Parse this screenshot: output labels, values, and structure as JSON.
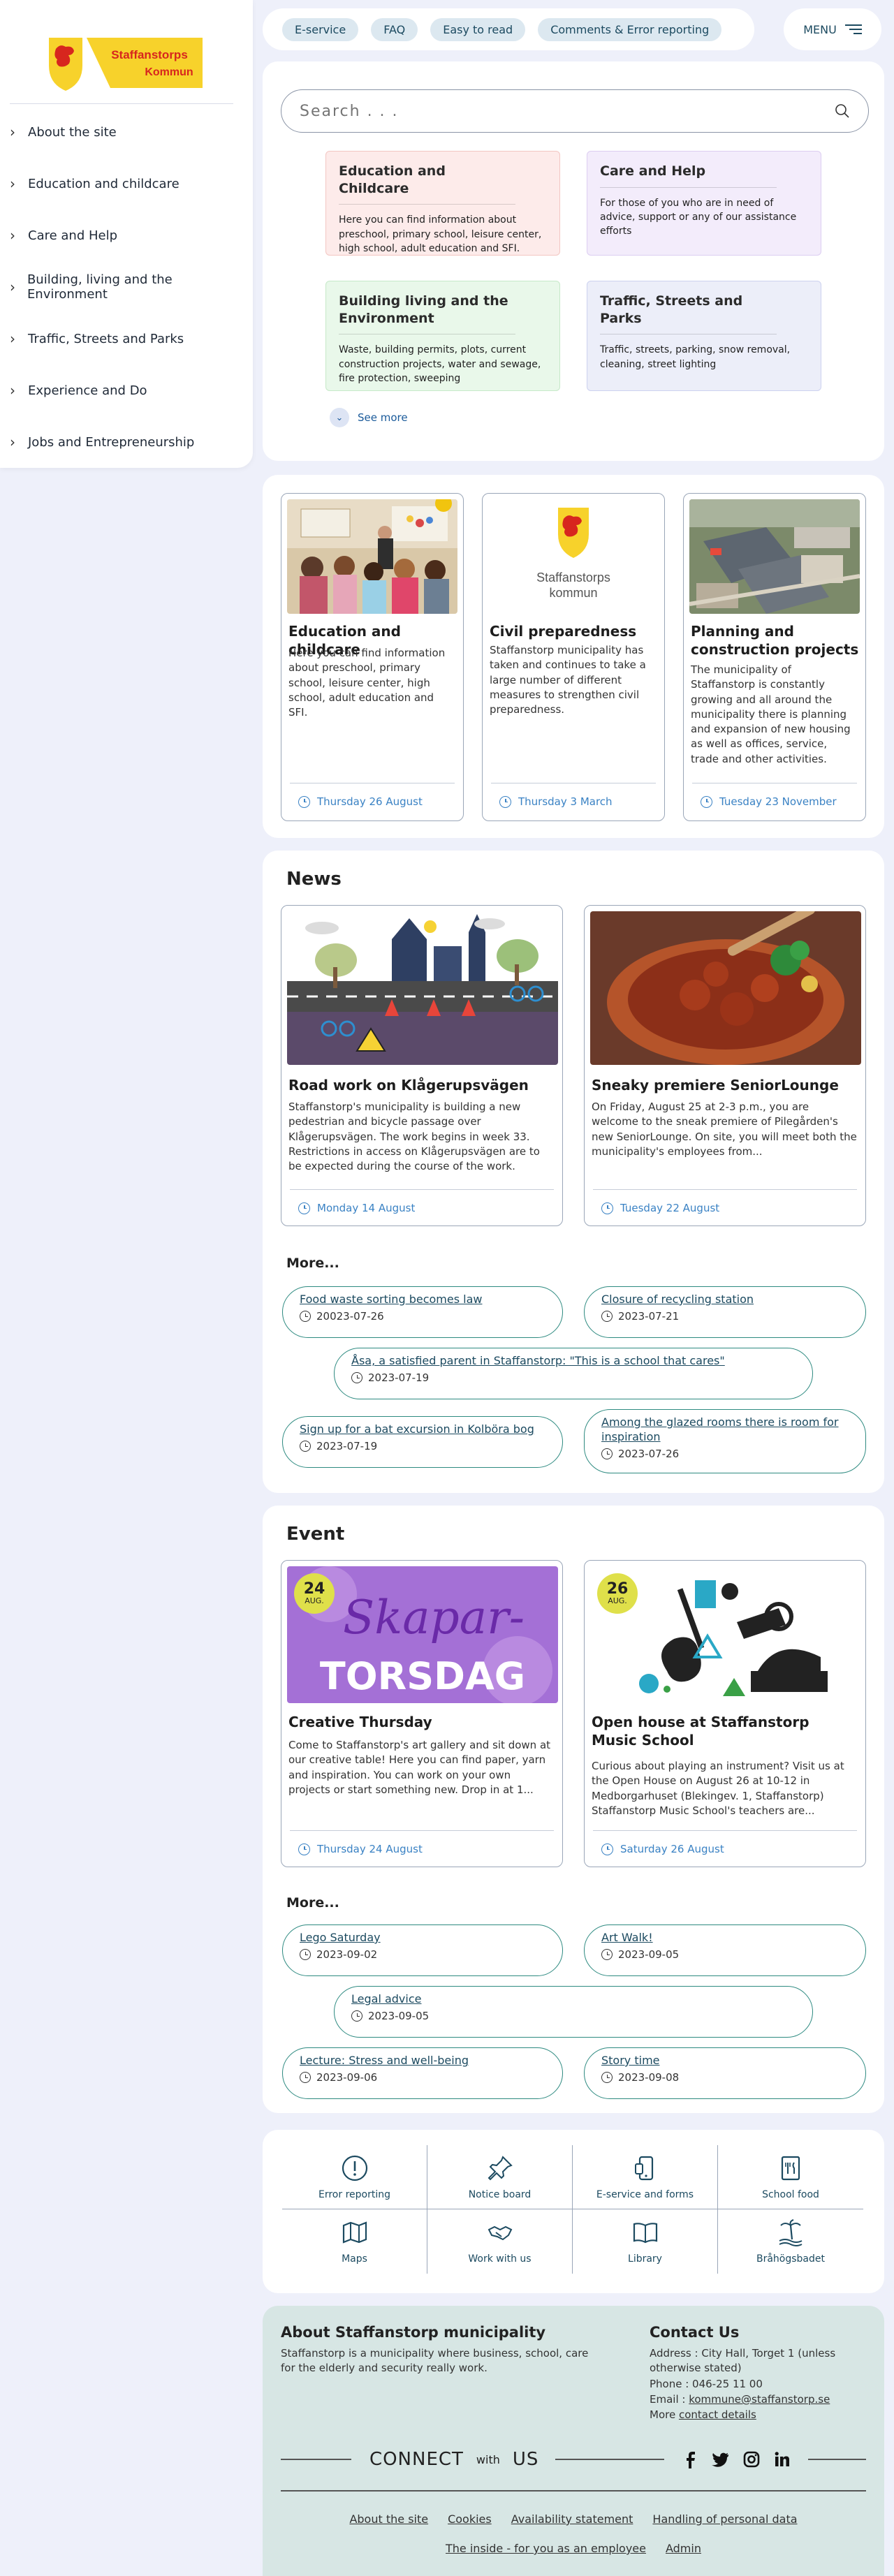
{
  "brand": {
    "name_line1": "Staffanstorps",
    "name_line2": "Kommun"
  },
  "topnav": {
    "items": [
      "E-service",
      "FAQ",
      "Easy to read",
      "Comments & Error reporting"
    ],
    "menu_label": "MENU"
  },
  "sidebar": {
    "items": [
      {
        "label": "About the site"
      },
      {
        "label": "Education and childcare"
      },
      {
        "label": "Care and Help"
      },
      {
        "label": "Building, living and the Environment"
      },
      {
        "label": "Traffic, Streets and Parks"
      },
      {
        "label": "Experience and Do"
      },
      {
        "label": "Jobs and Entrepreneurship"
      }
    ]
  },
  "search": {
    "placeholder": "Search . . ."
  },
  "categories": [
    {
      "title": "Education and Childcare",
      "text": "Here you can find information about preschool, primary school, leisure center, high school, adult education and SFI.",
      "color": "#fdebea",
      "border": "#f3c6c2"
    },
    {
      "title": "Care and Help",
      "text": "For those of you who are in need of advice, support or any of our assistance efforts",
      "color": "#f3ecfb",
      "border": "#dccdf1"
    },
    {
      "title": "Building living and the Environment",
      "text": "Waste, building permits, plots, current construction projects, water and sewage, fire protection, sweeping",
      "color": "#e9f8ea",
      "border": "#c6e9c8"
    },
    {
      "title": "Traffic, Streets and Parks",
      "text": "Traffic, streets, parking, snow removal, cleaning, street lighting",
      "color": "#eceef9",
      "border": "#ccd1ef"
    }
  ],
  "see_more": "See more",
  "features": [
    {
      "title": "Education and childcare",
      "text": "Here you can find information about preschool, primary school, leisure center, high school, adult education and SFI.",
      "date": "Thursday 26 August"
    },
    {
      "title": "Civil preparedness",
      "text": "Staffanstorp municipality has taken and continues to take a large number of different measures to strengthen civil preparedness.",
      "date": "Thursday 3 March",
      "logo_line1": "Staffanstorps",
      "logo_line2": "kommun"
    },
    {
      "title": "Planning and construction projects",
      "text": "The municipality of Staffanstorp is constantly growing and all around the municipality there is planning and expansion of new housing as well as offices, service, trade and other activities.",
      "date": "Tuesday 23 November"
    }
  ],
  "news": {
    "title": "News",
    "items": [
      {
        "title": "Road work on Klågerupsvägen",
        "text": "Staffanstorp's municipality is building a new pedestrian and bicycle passage over Klågerupsvägen. The work begins in week 33. Restrictions in access on Klågerupsvägen are to be expected during the course of the work.",
        "date": "Monday 14 August"
      },
      {
        "title": "Sneaky premiere SeniorLounge",
        "text": "On Friday, August 25 at 2-3 p.m., you are welcome to the sneak premiere of Pilegården's new SeniorLounge. On site, you will meet both the municipality's employees from...",
        "date": "Tuesday 22 August"
      }
    ],
    "more_title": "More...",
    "more": [
      {
        "title": "Food waste sorting becomes law",
        "date": "20023-07-26"
      },
      {
        "title": "Closure of recycling station",
        "date": "2023-07-21"
      },
      {
        "title": "Åsa, a satisfied parent in Staffanstorp: \"This is a school that cares\"",
        "date": "2023-07-19"
      },
      {
        "title": "Sign up for a bat excursion in Kolböra bog",
        "date": "2023-07-19"
      },
      {
        "title": "Among the glazed rooms there is room for inspiration",
        "date": "2023-07-26"
      }
    ]
  },
  "events": {
    "title": "Event",
    "items": [
      {
        "title": "Creative Thursday",
        "text": "Come to Staffanstorp's art gallery and sit down at our creative table! Here you can find paper, yarn and inspiration. You can work on your own projects or start something new. Drop in at 1...",
        "date": "Thursday 24 August",
        "badge_day": "24",
        "badge_month": "AUG.",
        "banner_line1": "Skapar-",
        "banner_line2": "TORSDAG"
      },
      {
        "title": "Open house at Staffanstorp Music School",
        "text": "Curious about playing an instrument? Visit us at the Open House on August 26 at 10-12 in Medborgarhuset (Blekingev. 1, Staffanstorp) Staffanstorp Music School's teachers are...",
        "date": "Saturday 26 August",
        "badge_day": "26",
        "badge_month": "AUG."
      }
    ],
    "more_title": "More...",
    "more": [
      {
        "title": "Lego Saturday",
        "date": "2023-09-02"
      },
      {
        "title": "Art Walk!",
        "date": "2023-09-05"
      },
      {
        "title": "Legal advice",
        "date": "2023-09-05"
      },
      {
        "title": "Lecture: Stress and well-being",
        "date": "2023-09-06"
      },
      {
        "title": "Story time",
        "date": "2023-09-08"
      }
    ]
  },
  "quicklinks": [
    {
      "label": "Error reporting",
      "icon": "alert-icon"
    },
    {
      "label": "Notice board",
      "icon": "pushpin-icon"
    },
    {
      "label": "E-service and forms",
      "icon": "mobile-icon"
    },
    {
      "label": "School food",
      "icon": "menu-book-icon"
    },
    {
      "label": "Maps",
      "icon": "map-icon"
    },
    {
      "label": "Work with us",
      "icon": "handshake-icon"
    },
    {
      "label": "Library",
      "icon": "book-icon"
    },
    {
      "label": "Bråhögsbadet",
      "icon": "beach-icon"
    }
  ],
  "footer": {
    "about_title": "About Staffanstorp municipality",
    "about_text": "Staffanstorp is a municipality where business, school, care for the elderly and security really work.",
    "contact_title": "Contact Us",
    "address": "Address : City Hall, Torget 1 (unless otherwise stated)",
    "phone": "Phone : 046-25 11 00",
    "email_label": "Email : ",
    "email": "kommune@staffanstorp.se",
    "more_label": "More ",
    "more_link": "contact details",
    "connect": "CONNECT",
    "with": "with",
    "us": "US",
    "links_row1": [
      "About the site",
      "Cookies",
      "Availability statement",
      "Handling of personal data"
    ],
    "links_row2": [
      "The inside - for you as an employee",
      "Admin"
    ]
  },
  "colors": {
    "accent": "#2d8a80",
    "link": "#1c4a60",
    "date": "#3a82c4",
    "badge": "#dfe04a",
    "footer_bg": "#d7e6e4"
  }
}
